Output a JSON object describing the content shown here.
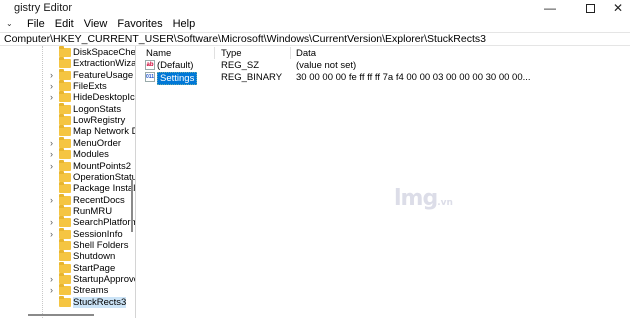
{
  "window": {
    "title": "gistry Editor",
    "minimize_glyph": "—",
    "close_glyph": "✕"
  },
  "menu": {
    "items": [
      "File",
      "Edit",
      "View",
      "Favorites",
      "Help"
    ]
  },
  "address": "Computer\\HKEY_CURRENT_USER\\Software\\Microsoft\\Windows\\CurrentVersion\\Explorer\\StuckRects3",
  "tree": {
    "items": [
      {
        "label": "DiskSpaceCheck",
        "expandable": false,
        "selected": false
      },
      {
        "label": "ExtractionWizar",
        "expandable": false,
        "selected": false
      },
      {
        "label": "FeatureUsage",
        "expandable": true,
        "selected": false
      },
      {
        "label": "FileExts",
        "expandable": true,
        "selected": false
      },
      {
        "label": "HideDesktopIco",
        "expandable": true,
        "selected": false
      },
      {
        "label": "LogonStats",
        "expandable": false,
        "selected": false
      },
      {
        "label": "LowRegistry",
        "expandable": false,
        "selected": false
      },
      {
        "label": "Map Network D",
        "expandable": false,
        "selected": false
      },
      {
        "label": "MenuOrder",
        "expandable": true,
        "selected": false
      },
      {
        "label": "Modules",
        "expandable": true,
        "selected": false
      },
      {
        "label": "MountPoints2",
        "expandable": true,
        "selected": false
      },
      {
        "label": "OperationStatus",
        "expandable": false,
        "selected": false
      },
      {
        "label": "Package Installa",
        "expandable": false,
        "selected": false
      },
      {
        "label": "RecentDocs",
        "expandable": true,
        "selected": false
      },
      {
        "label": "RunMRU",
        "expandable": false,
        "selected": false
      },
      {
        "label": "SearchPlatform",
        "expandable": true,
        "selected": false
      },
      {
        "label": "SessionInfo",
        "expandable": true,
        "selected": false
      },
      {
        "label": "Shell Folders",
        "expandable": false,
        "selected": false
      },
      {
        "label": "Shutdown",
        "expandable": false,
        "selected": false
      },
      {
        "label": "StartPage",
        "expandable": false,
        "selected": false
      },
      {
        "label": "StartupApprove",
        "expandable": true,
        "selected": false
      },
      {
        "label": "Streams",
        "expandable": true,
        "selected": false
      },
      {
        "label": "StuckRects3",
        "expandable": false,
        "selected": true
      }
    ]
  },
  "values": {
    "headers": {
      "name": "Name",
      "type": "Type",
      "data": "Data"
    },
    "rows": [
      {
        "name": "(Default)",
        "type": "REG_SZ",
        "data": "(value not set)",
        "icon": "string-value-icon",
        "icon_text": "ab",
        "selected": false
      },
      {
        "name": "Settings",
        "type": "REG_BINARY",
        "data": "30 00 00 00 fe ff ff ff 7a f4 00 00 03 00 00 00 30 00 00...",
        "icon": "binary-value-icon",
        "icon_text": "011",
        "selected": true
      }
    ]
  },
  "watermark": {
    "main": "lmg",
    "sub": ".vn"
  }
}
